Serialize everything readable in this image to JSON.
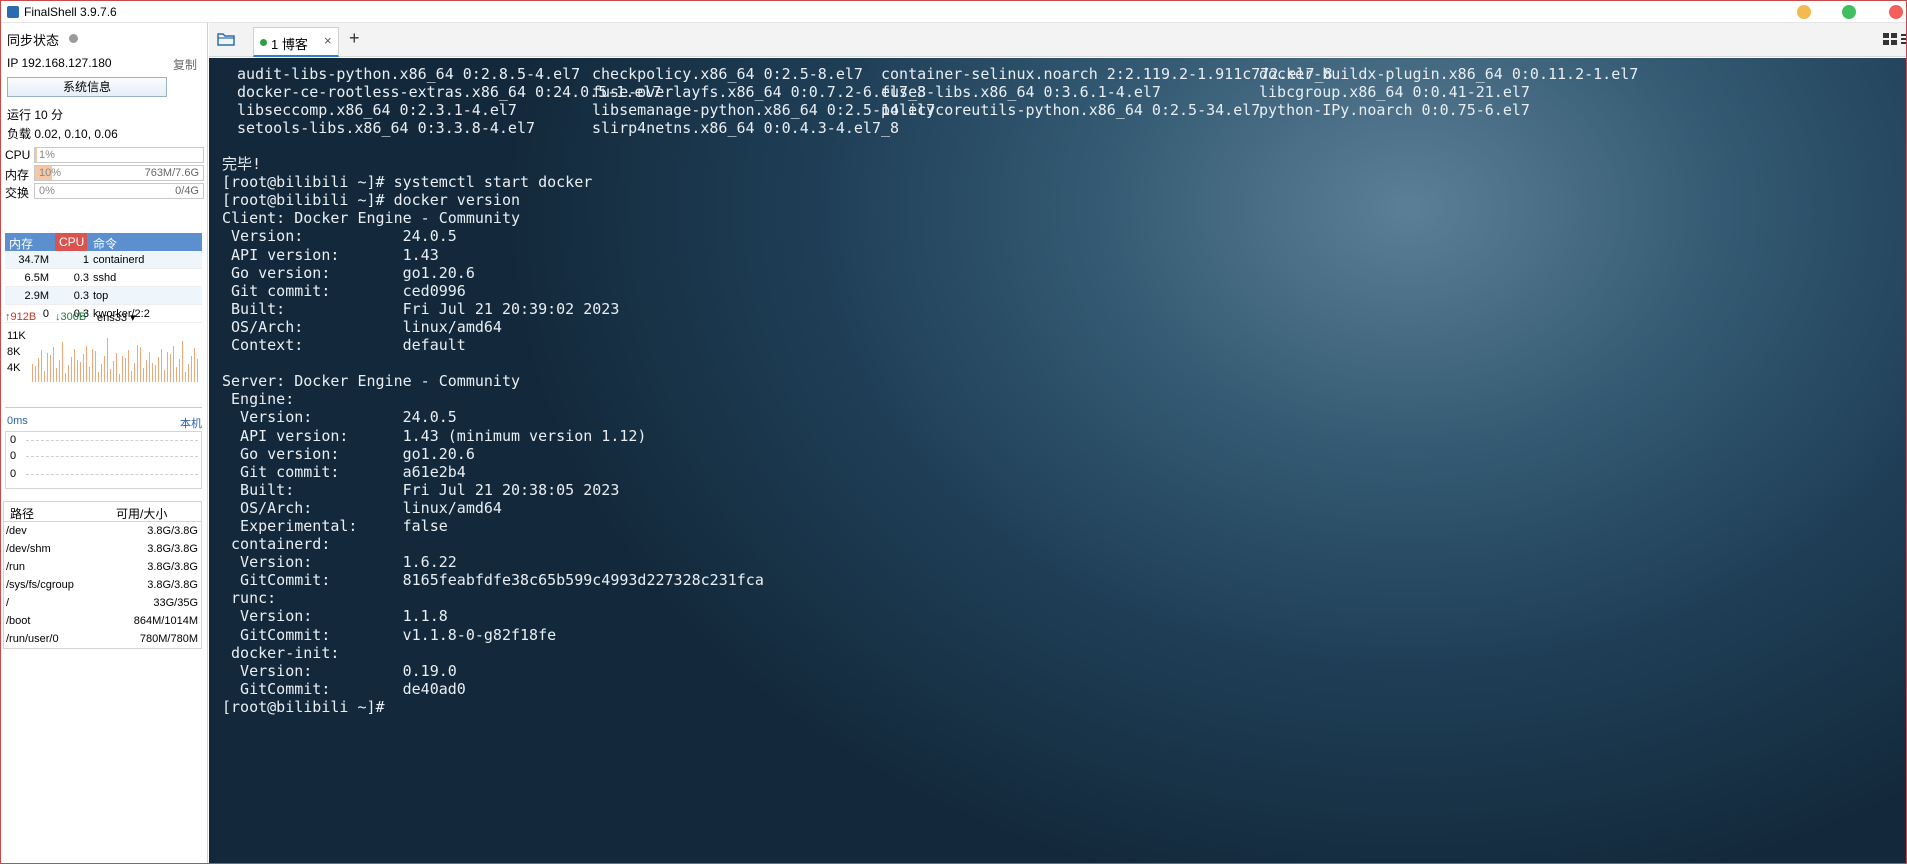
{
  "window": {
    "title": "FinalShell 3.9.7.6"
  },
  "sidebar": {
    "sync_label": "同步状态",
    "ip_label": "IP 192.168.127.180",
    "copy_label": "复制",
    "sysinfo_button": "系统信息",
    "uptime": "运行 10 分",
    "load": "负载 0.02, 0.10, 0.06",
    "cpu": {
      "label": "CPU",
      "percent_text": "1%",
      "fraction": 0.01,
      "value": ""
    },
    "mem": {
      "label": "内存",
      "percent_text": "10%",
      "fraction": 0.1,
      "value": "763M/7.6G"
    },
    "swap": {
      "label": "交换",
      "percent_text": "0%",
      "fraction": 0.0,
      "value": "0/4G"
    },
    "proc_headers": {
      "mem": "内存",
      "cpu": "CPU",
      "cmd": "命令"
    },
    "processes": [
      {
        "mem": "34.7M",
        "cpu": "1",
        "cmd": "containerd"
      },
      {
        "mem": "6.5M",
        "cpu": "0.3",
        "cmd": "sshd"
      },
      {
        "mem": "2.9M",
        "cpu": "0.3",
        "cmd": "top"
      },
      {
        "mem": "0",
        "cpu": "0.3",
        "cmd": "kworker/2:2"
      }
    ],
    "net": {
      "up": "912B",
      "down": "300B",
      "iface": "ens33",
      "yticks": [
        "11K",
        "8K",
        "4K"
      ]
    },
    "ping": {
      "ms": "0ms",
      "host": "本机",
      "values": [
        "0",
        "0",
        "0"
      ]
    },
    "disk_headers": {
      "path": "路径",
      "size": "可用/大小"
    },
    "disks": [
      {
        "path": "/dev",
        "size": "3.8G/3.8G"
      },
      {
        "path": "/dev/shm",
        "size": "3.8G/3.8G"
      },
      {
        "path": "/run",
        "size": "3.8G/3.8G"
      },
      {
        "path": "/sys/fs/cgroup",
        "size": "3.8G/3.8G"
      },
      {
        "path": "/",
        "size": "33G/35G"
      },
      {
        "path": "/boot",
        "size": "864M/1014M"
      },
      {
        "path": "/run/user/0",
        "size": "780M/780M"
      }
    ]
  },
  "tabs": {
    "active_label": "1 博客",
    "close": "×",
    "add": "+"
  },
  "terminal": {
    "packages": [
      [
        "audit-libs-python.x86_64 0:2.8.5-4.el7",
        "checkpolicy.x86_64 0:2.5-8.el7",
        "container-selinux.noarch 2:2.119.2-1.911c772.el7_8",
        "docker-buildx-plugin.x86_64 0:0.11.2-1.el7"
      ],
      [
        "docker-ce-rootless-extras.x86_64 0:24.0.5-1.el7",
        "fuse-overlayfs.x86_64 0:0.7.2-6.el7_8",
        "fuse3-libs.x86_64 0:3.6.1-4.el7",
        "libcgroup.x86_64 0:0.41-21.el7"
      ],
      [
        "libseccomp.x86_64 0:2.3.1-4.el7",
        "libsemanage-python.x86_64 0:2.5-14.el7",
        "policycoreutils-python.x86_64 0:2.5-34.el7",
        "python-IPy.noarch 0:0.75-6.el7"
      ],
      [
        "setools-libs.x86_64 0:3.3.8-4.el7",
        "slirp4netns.x86_64 0:0.4.3-4.el7_8",
        "",
        ""
      ]
    ],
    "lines": [
      "",
      "完毕!",
      "[root@bilibili ~]# systemctl start docker",
      "[root@bilibili ~]# docker version",
      "Client: Docker Engine - Community",
      " Version:           24.0.5",
      " API version:       1.43",
      " Go version:        go1.20.6",
      " Git commit:        ced0996",
      " Built:             Fri Jul 21 20:39:02 2023",
      " OS/Arch:           linux/amd64",
      " Context:           default",
      "",
      "Server: Docker Engine - Community",
      " Engine:",
      "  Version:          24.0.5",
      "  API version:      1.43 (minimum version 1.12)",
      "  Go version:       go1.20.6",
      "  Git commit:       a61e2b4",
      "  Built:            Fri Jul 21 20:38:05 2023",
      "  OS/Arch:          linux/amd64",
      "  Experimental:     false",
      " containerd:",
      "  Version:          1.6.22",
      "  GitCommit:        8165feabfdfe38c65b599c4993d227328c231fca",
      " runc:",
      "  Version:          1.1.8",
      "  GitCommit:        v1.1.8-0-g82f18fe",
      " docker-init:",
      "  Version:          0.19.0",
      "  GitCommit:        de40ad0",
      "[root@bilibili ~]# "
    ]
  }
}
